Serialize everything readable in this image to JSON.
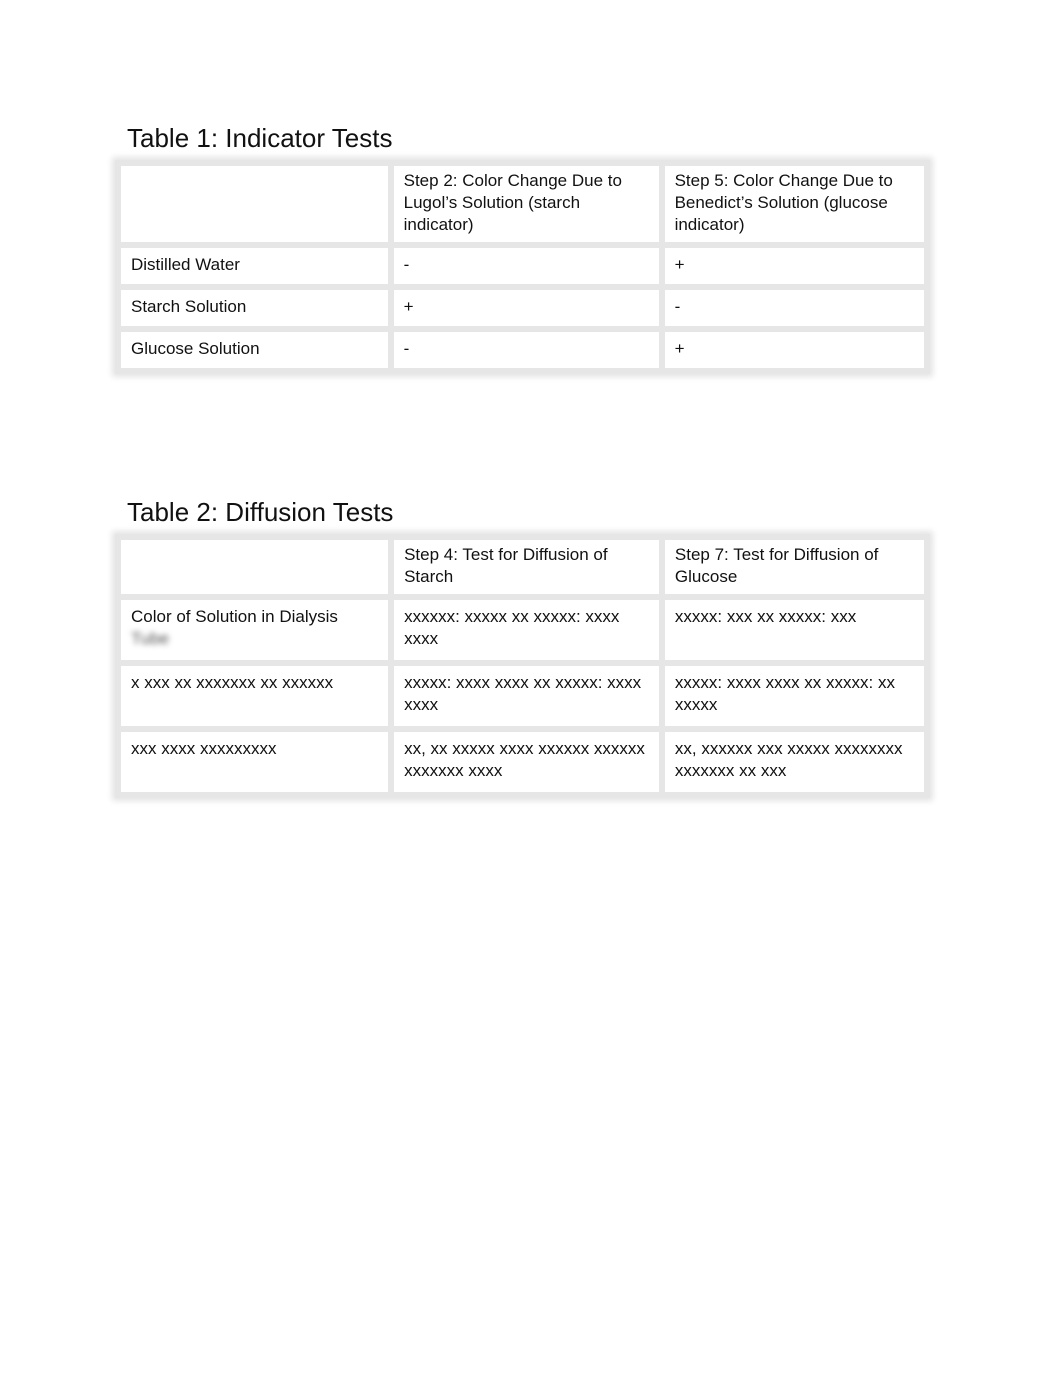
{
  "table1": {
    "title": "Table 1: Indicator Tests",
    "headers": [
      "",
      "Step 2: Color Change Due to Lugol’s Solution (starch indicator)",
      "Step 5: Color Change Due to Benedict’s Solution (glucose indicator)"
    ],
    "rows": [
      {
        "label": "Distilled Water",
        "lugol": "-",
        "benedict": "+"
      },
      {
        "label": "Starch Solution",
        "lugol": "+",
        "benedict": "-"
      },
      {
        "label": "Glucose Solution",
        "lugol": "-",
        "benedict": "+"
      }
    ]
  },
  "table2": {
    "title": "Table 2: Diffusion Tests",
    "headers": [
      "",
      "Step 4: Test for Diffusion of Starch",
      "Step 7: Test for Diffusion of Glucose"
    ],
    "rows": [
      {
        "label": "Color of Solution in Dialysis",
        "label_blurred": "Tube",
        "starch": "xxxxxx: xxxxx xx xxxxx: xxxx xxxx",
        "glucose": "xxxxx: xxx xx xxxxx: xxx"
      },
      {
        "label": "",
        "label_blurred": "x xxx xx xxxxxxx xx xxxxxx",
        "starch": "xxxxx: xxxx xxxx xx xxxxx: xxxx xxxx",
        "glucose": "xxxxx: xxxx xxxx xx xxxxx: xx xxxxx"
      },
      {
        "label": "",
        "label_blurred": "xxx xxxx xxxxxxxxx",
        "starch": "xx, xx xxxxx xxxx xxxxxx xxxxxx xxxxxxx xxxx",
        "glucose": "xx, xxxxxx xxx xxxxx xxxxxxxx xxxxxxx xx xxx"
      }
    ]
  }
}
